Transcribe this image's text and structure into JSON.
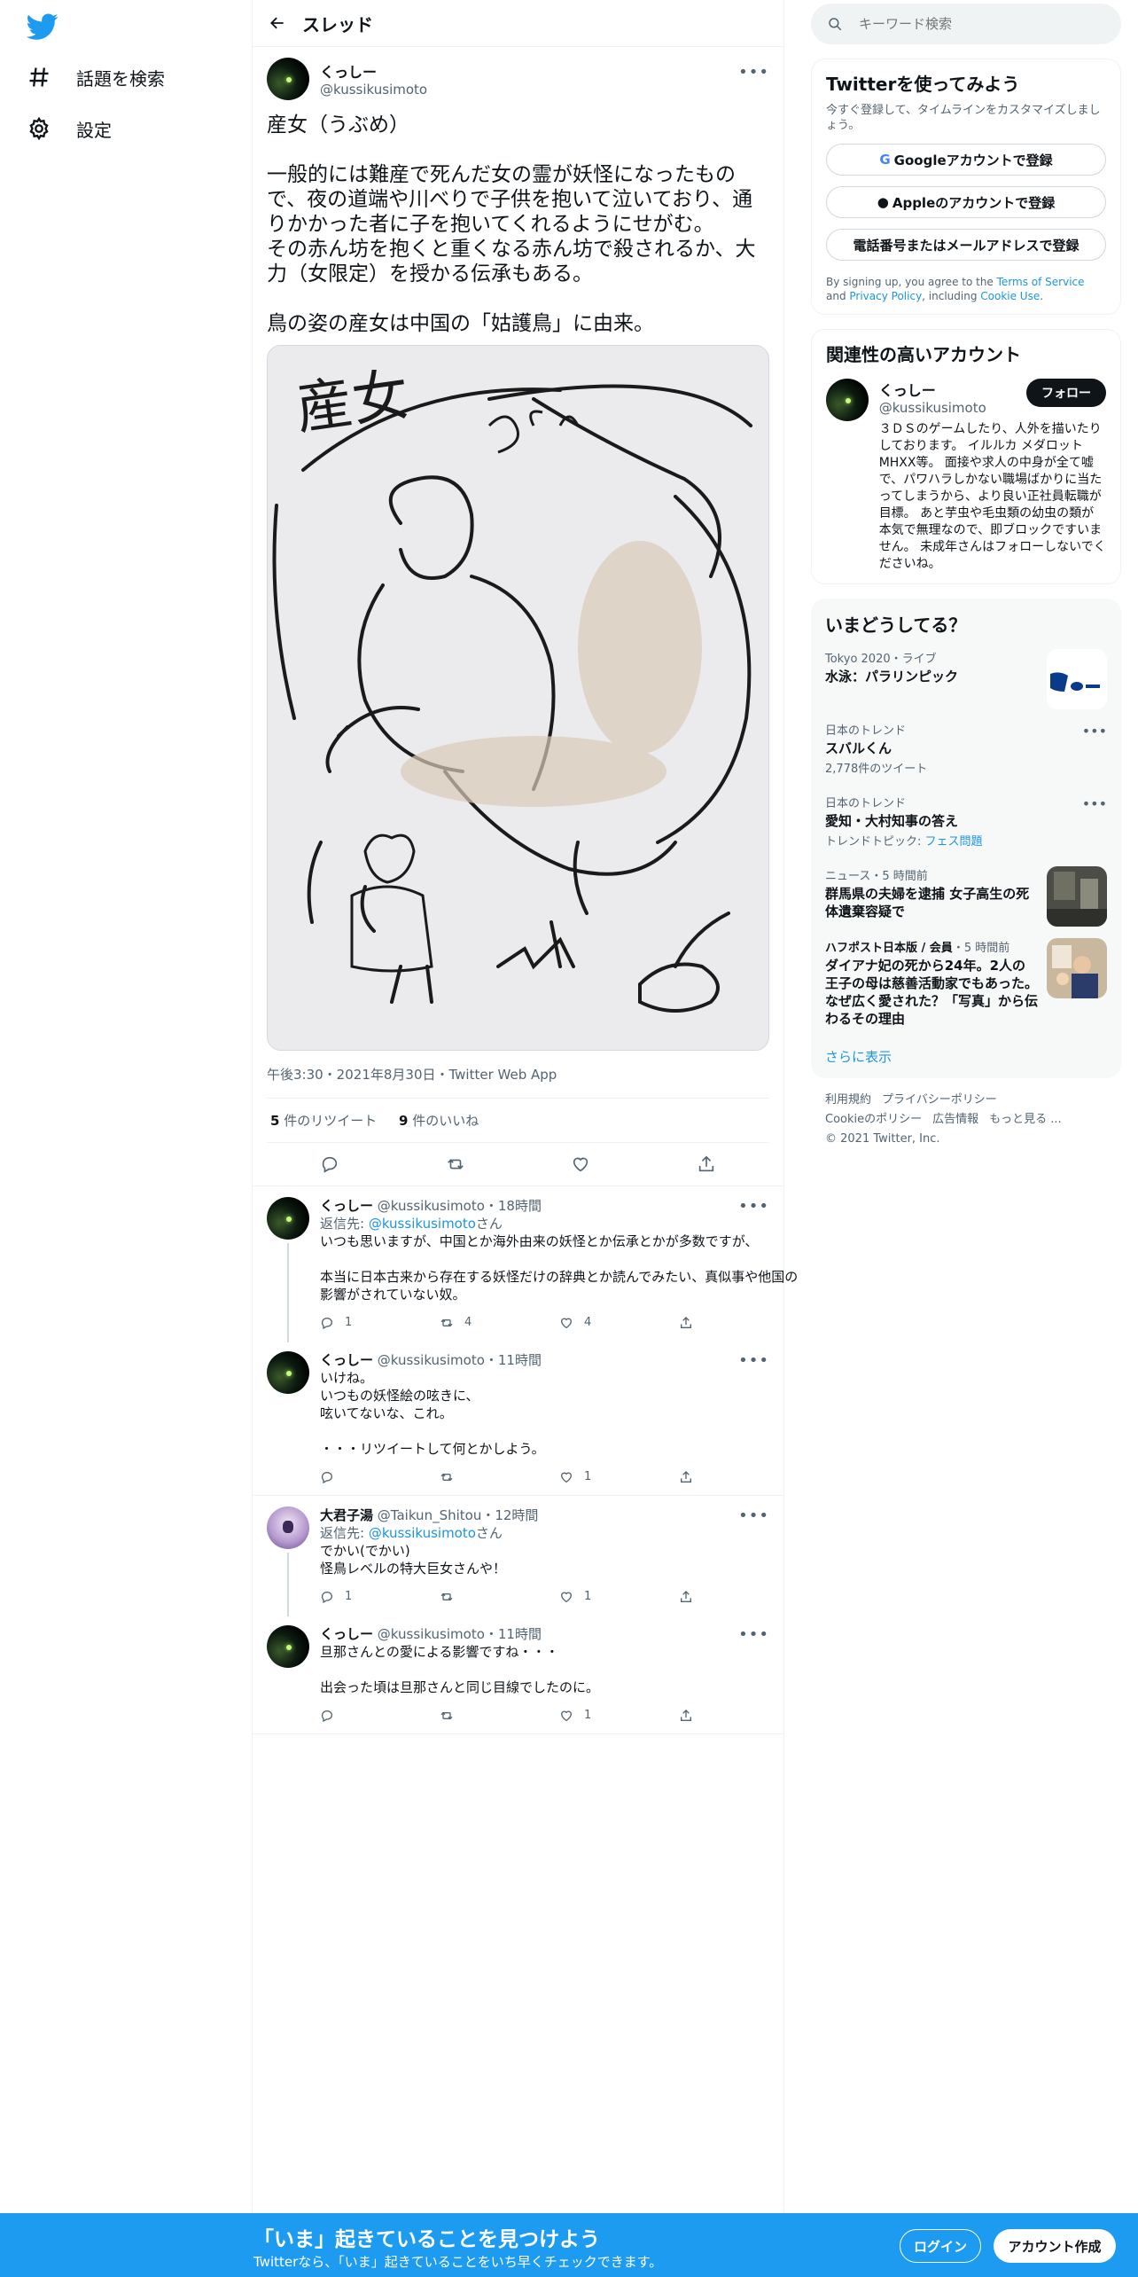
{
  "colors": {
    "brand": "#1d9bf0",
    "link": "#1b95e0",
    "text": "#0f1419",
    "muted": "#536471"
  },
  "nav": {
    "logo_icon": "twitter-bird-icon",
    "items": [
      {
        "label": "話題を検索",
        "icon": "hashtag-icon"
      },
      {
        "label": "設定",
        "icon": "gear-icon"
      }
    ]
  },
  "header": {
    "title": "スレッド",
    "back_icon": "arrow-left-icon"
  },
  "main_tweet": {
    "display_name": "くっしー",
    "handle": "@kussikusimoto",
    "text": "産女（うぶめ）\n\n一般的には難産で死んだ女の霊が妖怪になったもので、夜の道端や川べりで子供を抱いて泣いており、通りかかった者に子を抱いてくれるようにせがむ。\nその赤ん坊を抱くと重くなる赤ん坊で殺されるか、大力（女限定）を授かる伝承もある。\n\n鳥の姿の産女は中国の「姑護鳥」に由来。",
    "image_caption": "産女",
    "meta": "午後3:30・2021年8月30日・Twitter Web App",
    "retweets_count": "5",
    "retweets_label": "件のリツイート",
    "likes_count": "9",
    "likes_label": "件のいいね"
  },
  "replies": [
    {
      "display_name": "くっしー",
      "handle": "@kussikusimoto",
      "time": "・18時間",
      "reply_to_prefix": "返信先: ",
      "reply_to_handle": "@kussikusimoto",
      "reply_to_suffix": "さん",
      "text": "いつも思いますが、中国とか海外由来の妖怪とか伝承とかが多数ですが、\n\n本当に日本古来から存在する妖怪だけの辞典とか読んでみたい、真似事や他国の影響がされていない奴。",
      "replies": "1",
      "retweets": "4",
      "likes": "4"
    },
    {
      "display_name": "くっしー",
      "handle": "@kussikusimoto",
      "time": "・11時間",
      "text": "いけね。\nいつもの妖怪絵の呟きに、\n呟いてないな、これ。\n\n・・・リツイートして何とかしよう。",
      "replies": "",
      "retweets": "",
      "likes": "1"
    },
    {
      "display_name": "大君子湯",
      "handle": "@Taikun_Shitou",
      "time": "・12時間",
      "reply_to_prefix": "返信先: ",
      "reply_to_handle": "@kussikusimoto",
      "reply_to_suffix": "さん",
      "text": "でかい(でかい)\n怪鳥レベルの特大巨女さんや！",
      "replies": "1",
      "retweets": "",
      "likes": "1"
    },
    {
      "display_name": "くっしー",
      "handle": "@kussikusimoto",
      "time": "・11時間",
      "text": "旦那さんとの愛による影響ですね・・・\n\n出会った頃は旦那さんと同じ目線でしたのに。",
      "replies": "",
      "retweets": "",
      "likes": "1"
    }
  ],
  "search": {
    "placeholder": "キーワード検索"
  },
  "signup_card": {
    "title": "Twitterを使ってみよう",
    "subtitle": "今すぐ登録して、タイムラインをカスタマイズしましょう。",
    "google_label": "Googleアカウントで登録",
    "apple_label": "Appleのアカウントで登録",
    "phone_label": "電話番号またはメールアドレスで登録",
    "terms_prefix": "By signing up, you agree to the ",
    "terms_link": "Terms of Service",
    "terms_and": " and ",
    "privacy_link": "Privacy Policy",
    "terms_including": ", including ",
    "cookie_link": "Cookie Use",
    "terms_end": "."
  },
  "relevant": {
    "title": "関連性の高いアカウント",
    "display_name": "くっしー",
    "handle": "@kussikusimoto",
    "follow_label": "フォロー",
    "bio": "３ＤＳのゲームしたり、人外を描いたりしております。 イルルカ メダロット MHXX等。 面接や求人の中身が全て嘘で、パワハラしかない職場ばかりに当たってしまうから、より良い正社員転職が目標。 あと芋虫や毛虫類の幼虫の類が本気で無理なので、即ブロックですいません。 未成年さんはフォローしないでくださいね。"
  },
  "trends": {
    "title": "いまどうしてる？",
    "items": [
      {
        "context": "Tokyo 2020・ライブ",
        "name": "水泳：パラリンピック"
      },
      {
        "context": "日本のトレンド",
        "name": "スバルくん",
        "count": "2,778件のツイート"
      },
      {
        "context": "日本のトレンド",
        "name": "愛知・大村知事の答え",
        "topic_prefix": "トレンドトピック: ",
        "topic": "フェス問題"
      },
      {
        "context": "ニュース・5 時間前",
        "name": "群馬県の夫婦を逮捕 女子高生の死体遺棄容疑で"
      },
      {
        "context_source": "ハフポスト日本版 / 会員",
        "context_time": "・5 時間前",
        "name": "ダイアナ妃の死から24年。2人の王子の母は慈善活動家でもあった。なぜ広く愛された？「写真」から伝わるその理由"
      }
    ],
    "show_more": "さらに表示"
  },
  "footer": {
    "links": [
      "利用規約",
      "プライバシーポリシー",
      "Cookieのポリシー",
      "広告情報",
      "もっと見る ..."
    ],
    "copyright": "© 2021 Twitter, Inc."
  },
  "bottom_bar": {
    "headline": "「いま」起きていることを見つけよう",
    "subline": "Twitterなら、「いま」起きていることをいち早くチェックできます。",
    "login_label": "ログイン",
    "signup_label": "アカウント作成"
  }
}
